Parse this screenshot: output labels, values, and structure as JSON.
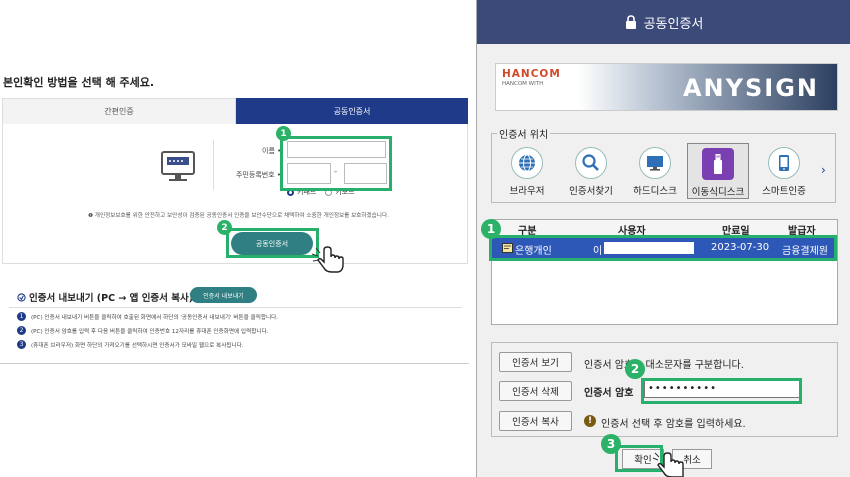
{
  "left": {
    "title": "본인확인 방법을 선택 해 주세요.",
    "tabs": [
      {
        "label": "간편인증",
        "active": false
      },
      {
        "label": "공동인증서",
        "active": true
      }
    ],
    "form": {
      "name_label": "이름 •",
      "rrn_label": "주민등록번호 •",
      "rrn_dash": "-",
      "radio_keypad": "키패드",
      "radio_keyboard": "키보드"
    },
    "notice": "❶ 개인정보보호를 위한 안전하고 보안성이 검증된 공동인증서 인증을 보안수단으로 채택하여 소중한 개인정보를 보호하겠습니다.",
    "cert_button": "공동인증서",
    "badges": {
      "one": "1",
      "two": "2",
      "three": "3"
    },
    "export": {
      "title": "인증서 내보내기 (PC → 앱 인증서 복사)",
      "button": "인증서 내보내기",
      "steps": [
        {
          "num": "1",
          "text": "(PC) 인증서 내보내기 버튼을 클릭하여 호출된 화면에서 하단의 '공동인증서 내보내기' 버튼을 클릭합니다."
        },
        {
          "num": "2",
          "text": "(PC) 인증서 암호를 입력 후 다음 버튼을 클릭하여 인증번호 12자리를 휴대폰 인증화면에 입력합니다."
        },
        {
          "num": "3",
          "text": "(휴대폰 브라우저) 화면 하단의 가져오기를 선택하시면 인증서가 모바일 웹으로 복사됩니다."
        }
      ]
    }
  },
  "dialog": {
    "title": "공동인증서",
    "banner": {
      "hancom": "HANCOM",
      "hancom_sub": "HANCOM WITH",
      "product": "ANYSIGN"
    },
    "location": {
      "legend": "인증서 위치",
      "items": [
        {
          "label": "브라우저",
          "icon": "globe-icon"
        },
        {
          "label": "인증서찾기",
          "icon": "search-icon"
        },
        {
          "label": "하드디스크",
          "icon": "monitor-icon"
        },
        {
          "label": "이동식디스크",
          "icon": "usb-icon",
          "selected": true
        },
        {
          "label": "스마트인증",
          "icon": "smartphone-icon"
        }
      ],
      "next": "›"
    },
    "table": {
      "headers": [
        "구분",
        "사용자",
        "만료일",
        "발급자"
      ],
      "rows": [
        {
          "type": "은행개인",
          "user": "이",
          "expiry": "2023-07-30",
          "issuer": "금융결제원"
        }
      ]
    },
    "buttons": {
      "view": "인증서 보기",
      "delete": "인증서 삭제",
      "copy": "인증서 복사",
      "ok": "확인",
      "cancel": "취소"
    },
    "case_notice": "인증서 암호는 대소문자를 구분합니다.",
    "pw_label": "인증서 암호",
    "pw_value": "••••••••••",
    "hint": "인증서 선택 후 암호를 입력하세요.",
    "colors": {
      "header": "#3c4a7a",
      "selected_row": "#2e58b8",
      "highlight": "#27b06b"
    }
  }
}
